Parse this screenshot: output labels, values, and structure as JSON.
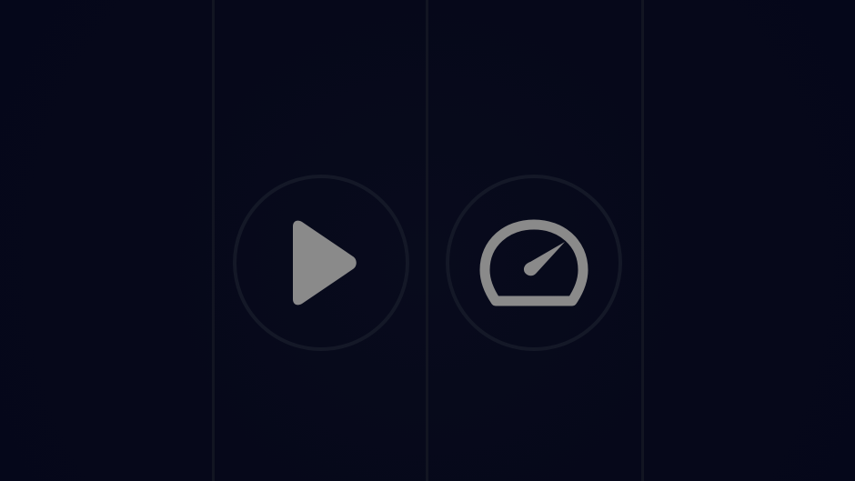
{
  "theme": {
    "background": "#06081a",
    "divider": "#121522",
    "ring": "#141827",
    "icon": "#8a8a8a"
  },
  "controls": [
    {
      "id": "play",
      "icon": "play-icon"
    },
    {
      "id": "speed",
      "icon": "speedometer-icon"
    }
  ]
}
